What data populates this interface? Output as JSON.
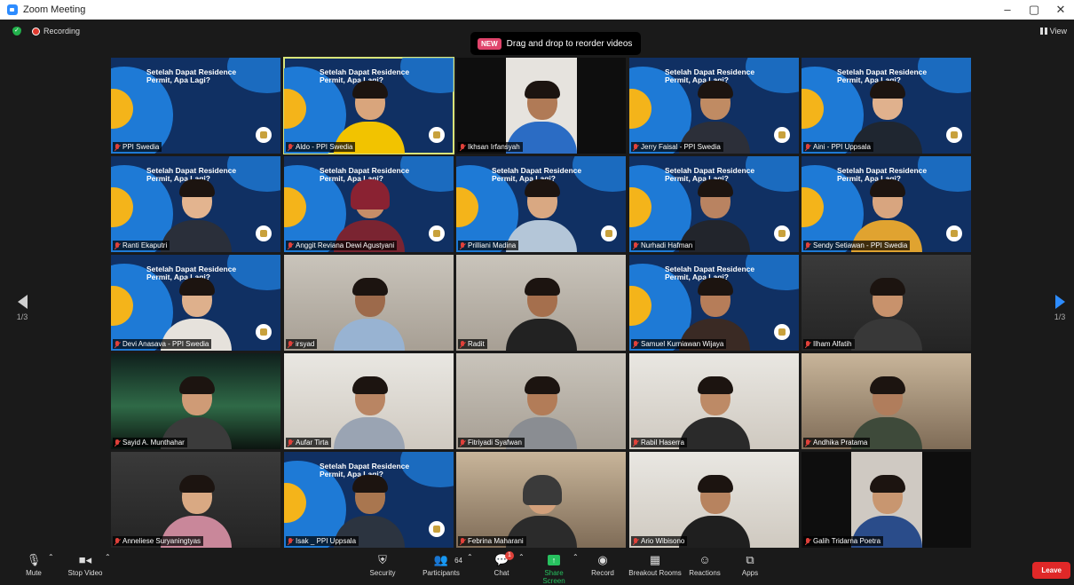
{
  "window": {
    "title": "Zoom Meeting",
    "controls": [
      "–",
      "▢",
      "✕"
    ]
  },
  "topbar": {
    "recording_label": "Recording",
    "view_label": "View"
  },
  "toast": {
    "badge": "NEW",
    "text": "Drag and drop to reorder videos"
  },
  "pager": {
    "left": "1/3",
    "right": "1/3"
  },
  "backdrop_title": "Setelah Dapat Residence Permit, Apa Lagi?",
  "participants": [
    {
      "name": "PPI Swedia"
    },
    {
      "name": "Aldo - PPI Swedia"
    },
    {
      "name": "Ikhsan Irfansyah"
    },
    {
      "name": "Jerry Faisal - PPI Swedia"
    },
    {
      "name": "Aini - PPI Uppsala"
    },
    {
      "name": "Ranti Ekaputri"
    },
    {
      "name": "Anggit Reviana Dewi Agustyani"
    },
    {
      "name": "Prilliani Madina"
    },
    {
      "name": "Nurhadi Hafman"
    },
    {
      "name": "Sendy Setiawan - PPI Swedia"
    },
    {
      "name": "Devi Anasava - PPI Swedia"
    },
    {
      "name": "irsyad"
    },
    {
      "name": "Radit"
    },
    {
      "name": "Samuel Kurniawan Wijaya"
    },
    {
      "name": "Ilham Alfatih"
    },
    {
      "name": "Sayid A. Munthahar"
    },
    {
      "name": "Aufar Tirta"
    },
    {
      "name": "Fitriyadi Syafwan"
    },
    {
      "name": "Rabil Haserra"
    },
    {
      "name": "Andhika Pratama"
    },
    {
      "name": "Anneliese Suryaningtyas"
    },
    {
      "name": "Isak _ PPI Uppsala"
    },
    {
      "name": "Febrina Maharani"
    },
    {
      "name": "Ario Wibisono"
    },
    {
      "name": "Galih Tridarna Poetra"
    }
  ],
  "toolbar": {
    "mute": "Mute",
    "stop_video": "Stop Video",
    "security": "Security",
    "participants": "Participants",
    "participants_count": "64",
    "chat": "Chat",
    "chat_badge": "1",
    "share_screen": "Share Screen",
    "record": "Record",
    "breakout_rooms": "Breakout Rooms",
    "reactions": "Reactions",
    "apps": "Apps",
    "leave": "Leave"
  }
}
